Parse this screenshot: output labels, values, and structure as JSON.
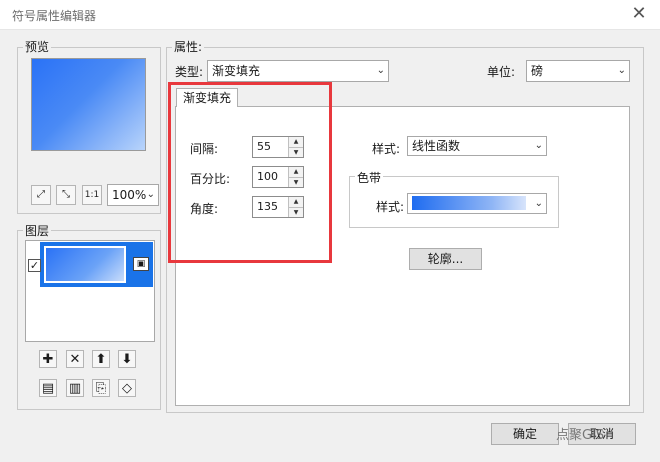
{
  "window": {
    "title": "符号属性编辑器",
    "close_glyph": "✕"
  },
  "preview": {
    "label": "预览",
    "zoom_value": "100%",
    "tools": [
      "⤢",
      "⤡",
      "1:1"
    ]
  },
  "layers": {
    "label": "图层",
    "checked": true,
    "toolbar_row1": [
      "✚",
      "✕",
      "⬆",
      "⬇"
    ],
    "toolbar_row2": [
      "▤",
      "▥",
      "⎘",
      "◇"
    ]
  },
  "properties": {
    "label": "属性:",
    "type_label": "类型:",
    "type_value": "渐变填充",
    "unit_label": "单位:",
    "unit_value": "磅",
    "tab_label": "渐变填充",
    "interval_label": "间隔:",
    "interval_value": "55",
    "percent_label": "百分比:",
    "percent_value": "100",
    "angle_label": "角度:",
    "angle_value": "135",
    "style_label": "样式:",
    "style_value": "线性函数",
    "colorramp_label": "色带",
    "ramp_style_label": "样式:",
    "outline_button": "轮廓..."
  },
  "footer": {
    "ok_button": "确定",
    "cancel_button": "取消",
    "watermark": "点聚GIS"
  },
  "colors": {
    "highlight_red": "#e8383d",
    "selection_blue": "#1a73e8",
    "gradient_start": "#2a72f6",
    "gradient_end": "#c9ddfb"
  }
}
